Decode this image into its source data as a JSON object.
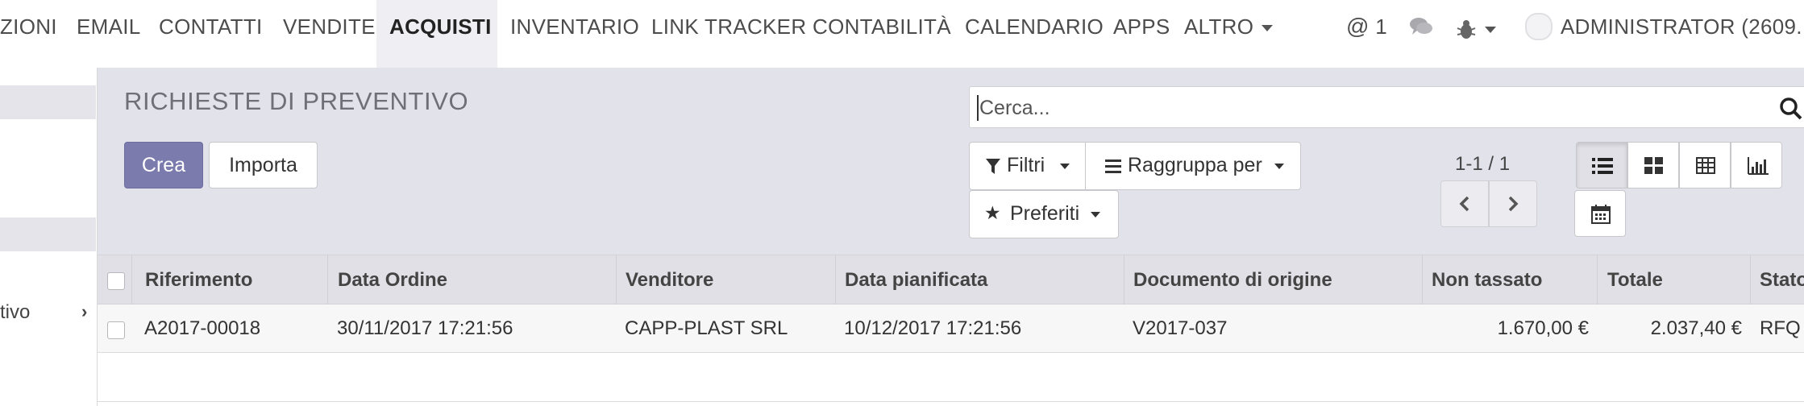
{
  "nav": {
    "items": [
      {
        "label": "ZIONI"
      },
      {
        "label": "EMAIL"
      },
      {
        "label": "CONTATTI"
      },
      {
        "label": "VENDITE"
      },
      {
        "label": "ACQUISTI"
      },
      {
        "label": "INVENTARIO"
      },
      {
        "label": "LINK TRACKER"
      },
      {
        "label": "CONTABILITÀ"
      },
      {
        "label": "CALENDARIO"
      },
      {
        "label": "APPS"
      },
      {
        "label": "ALTRO"
      }
    ],
    "active": "ACQUISTI",
    "mention_count": "1",
    "user_label": "ADMINISTRATOR (2609..."
  },
  "sidebar": {
    "item_label": "tivo"
  },
  "page": {
    "title": "RICHIESTE DI PREVENTIVO"
  },
  "buttons": {
    "create": "Crea",
    "import": "Importa"
  },
  "search": {
    "placeholder": "Cerca..."
  },
  "filters": {
    "filters_label": "Filtri",
    "group_by_label": "Raggruppa per",
    "favorites_label": "Preferiti"
  },
  "pager": {
    "text": "1-1 / 1"
  },
  "views": [
    "list",
    "kanban",
    "pivot",
    "graph",
    "calendar"
  ],
  "table": {
    "columns": [
      "Riferimento",
      "Data Ordine",
      "Venditore",
      "Data pianificata",
      "Documento di origine",
      "Non tassato",
      "Totale",
      "Stato"
    ],
    "rows": [
      [
        "A2017-00018",
        "30/11/2017 17:21:56",
        "CAPP-PLAST SRL",
        "10/12/2017 17:21:56",
        "V2017-037",
        "1.670,00 €",
        "2.037,40 €",
        "RFQ"
      ]
    ]
  },
  "colors": {
    "primary": "#7c7bad",
    "header_bg": "#e2e2ea",
    "table_head_bg": "#e0e0e6"
  }
}
